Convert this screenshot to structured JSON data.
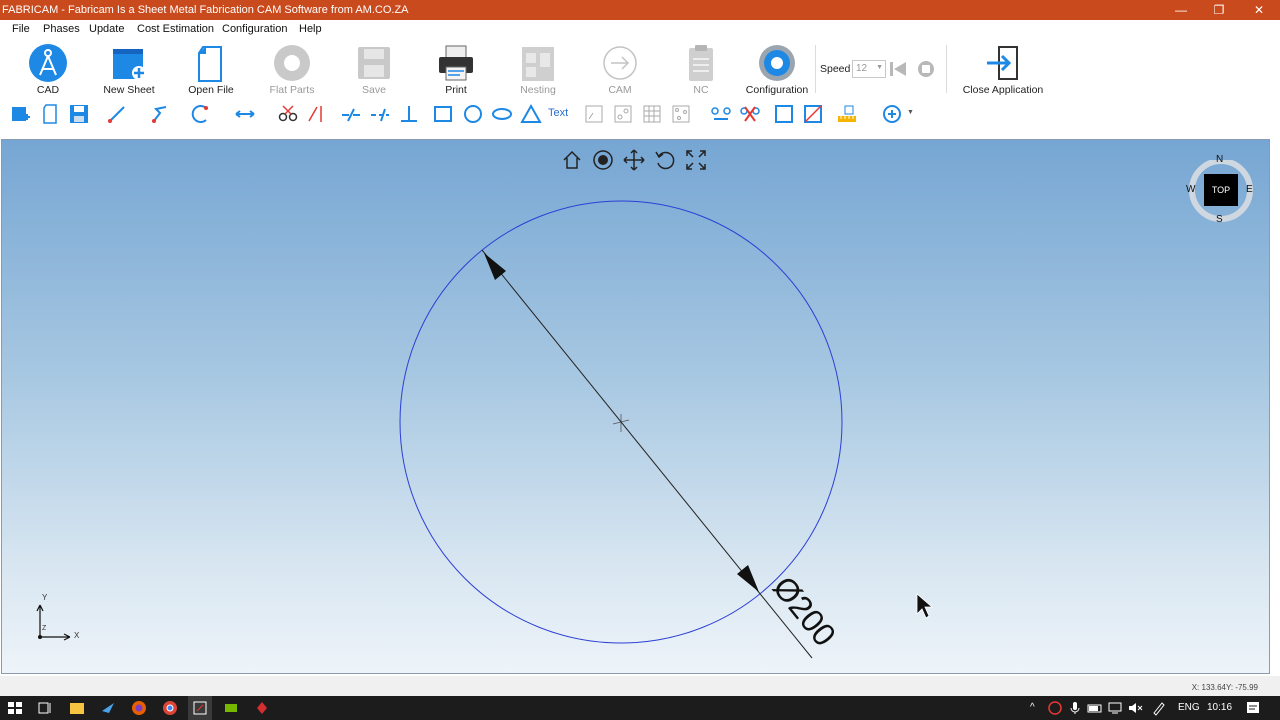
{
  "window": {
    "title": "FABRICAM - Fabricam Is a Sheet Metal Fabrication CAM Software from AM.CO.ZA",
    "minimize": "—",
    "restore": "❐",
    "close": "✕"
  },
  "menu": [
    "File",
    "Phases",
    "Update",
    "Cost Estimation",
    "Configuration",
    "Help"
  ],
  "ribbon": {
    "cad": "CAD",
    "new_sheet": "New Sheet",
    "open_file": "Open File",
    "flat_parts": "Flat Parts",
    "save": "Save",
    "print": "Print",
    "nesting": "Nesting",
    "cam": "CAM",
    "nc": "NC",
    "configuration": "Configuration",
    "speed_label": "Speed",
    "speed_value": "12",
    "close_application": "Close Application"
  },
  "toolbar": {
    "text_tool": "Text"
  },
  "viewport": {
    "dimension_label": "Ø200",
    "navcube": {
      "top": "TOP",
      "n": "N",
      "s": "S",
      "e": "E",
      "w": "W"
    },
    "axis": {
      "x": "X",
      "y": "Y",
      "z": "Z"
    },
    "circle_color": "#2b3fd6"
  },
  "status": {
    "coordinates": "X: 133.64Y: -75.99"
  },
  "taskbar": {
    "language": "ENG",
    "time": "10:16"
  }
}
